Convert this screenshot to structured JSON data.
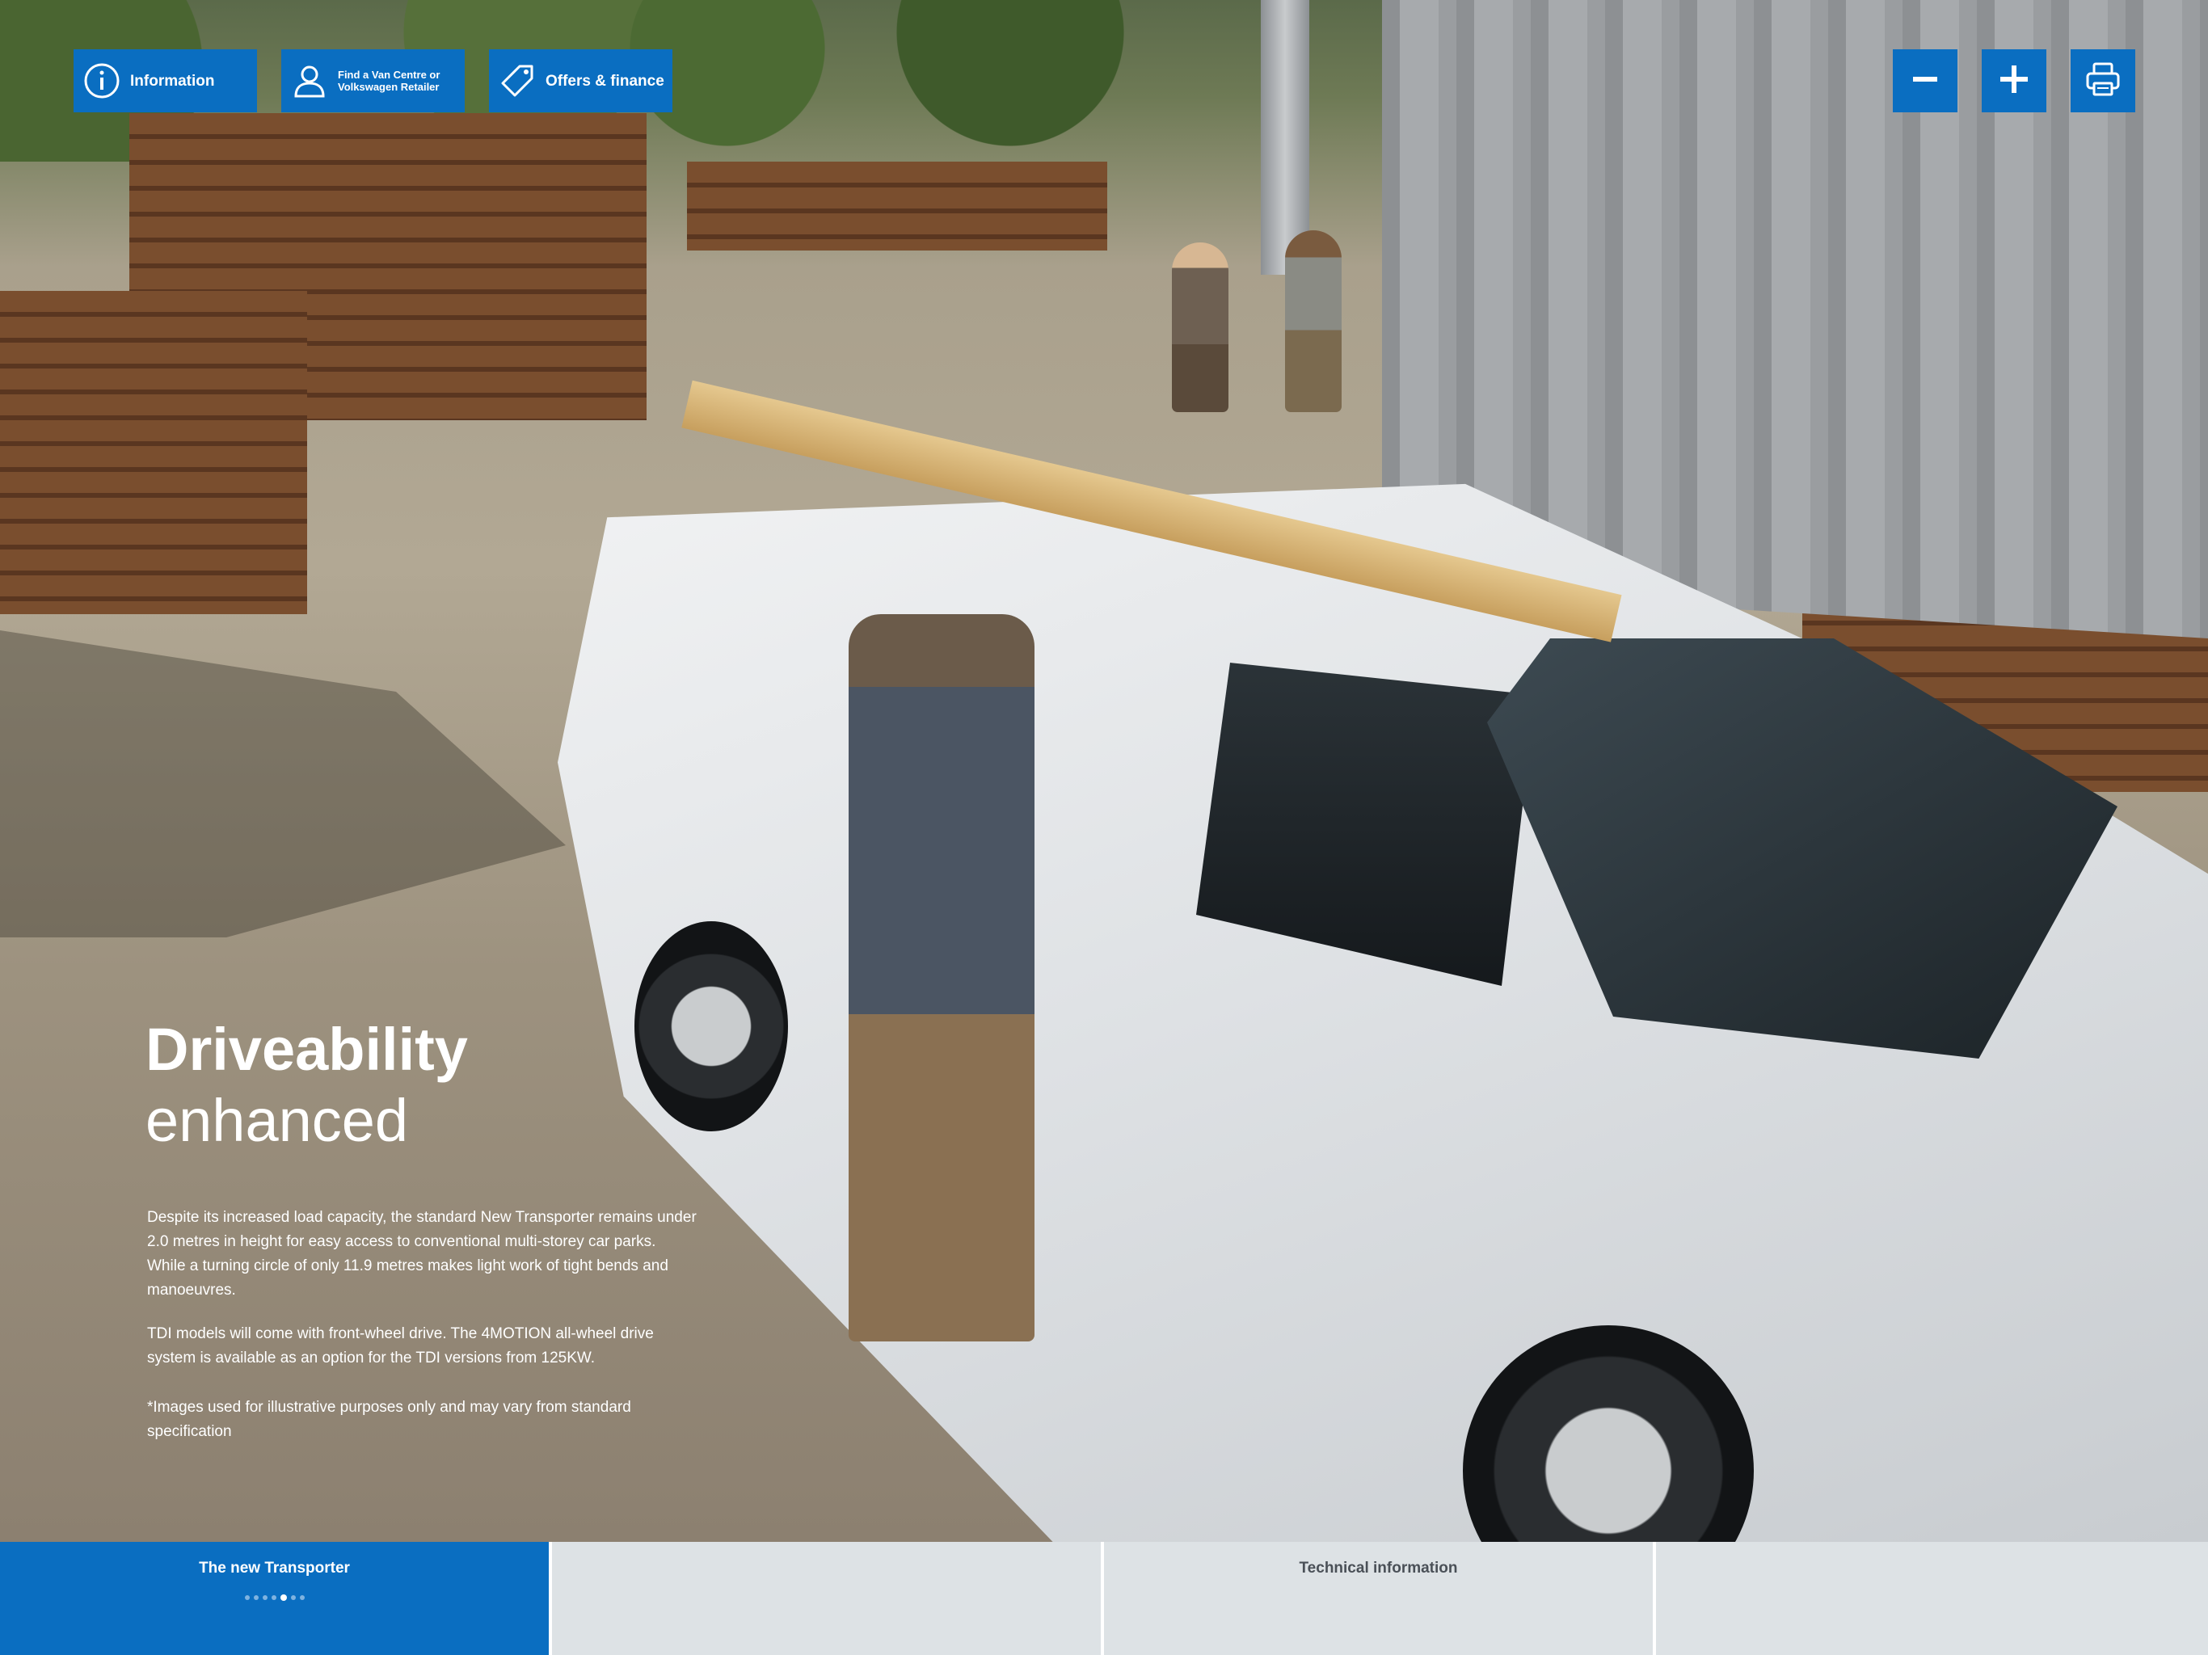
{
  "toolbar": {
    "information_label": "Information",
    "find_line1": "Find a Van Centre or",
    "find_line2": "Volkswagen Retailer",
    "offers_label": "Offers & finance"
  },
  "controls": {
    "zoom_out_icon": "minus-icon",
    "zoom_in_icon": "plus-icon",
    "print_icon": "printer-icon"
  },
  "content": {
    "heading_bold": "Driveability",
    "heading_light": "enhanced",
    "paragraph1": "Despite its increased load capacity, the standard  New Transporter remains under 2.0 metres in height  for easy access to conventional multi-storey car parks. While a turning circle of only 11.9 metres makes light work of tight bends and manoeuvres.",
    "paragraph2": "TDI models will come with front-wheel drive. The 4MOTION all-wheel drive system is available as an option for the TDI versions from 125KW.",
    "paragraph3": "*Images used for illustrative purposes only and may vary from standard specification"
  },
  "bottom_nav": {
    "tabs": [
      {
        "label": "The new Transporter",
        "active": true
      },
      {
        "label": "",
        "active": false
      },
      {
        "label": "Technical information",
        "active": false
      },
      {
        "label": "",
        "active": false
      }
    ],
    "page_dots_total": 7,
    "page_dots_current": 5
  },
  "colors": {
    "accent": "#0a6ec1",
    "nav_background": "#dde2e5"
  }
}
